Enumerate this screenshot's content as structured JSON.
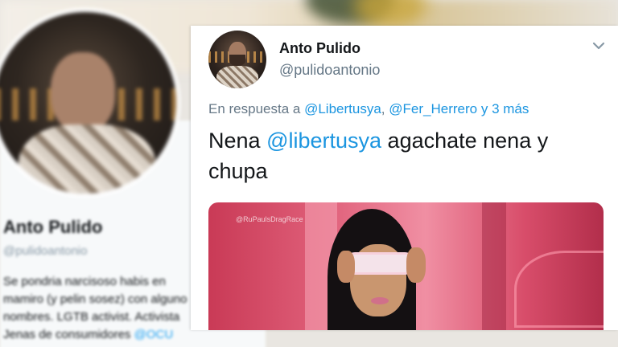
{
  "background_profile": {
    "name": "Anto Pulido",
    "handle": "@pulidoantonio",
    "bio_lines": [
      "Se pondria narcisoso habis en",
      "mamiro (y pelin sosez) con alguno",
      "nombres. LGTB activist. Activista",
      "Jenas de consumidores"
    ],
    "bio_link": "@OCU"
  },
  "tweet": {
    "author_name": "Anto Pulido",
    "author_handle": "@pulidoantonio",
    "menu_icon": "chevron-down-icon",
    "reply_prefix": "En respuesta a",
    "reply_user_1": "@Libertusya",
    "reply_separator": ",",
    "reply_user_2": "@Fer_Herrero",
    "reply_suffix": "y 3 más",
    "text_before": "Nena",
    "text_mention": "@libertusya",
    "text_after": "agachate nena y chupa",
    "media_watermark": "@RuPaulsDragRace"
  },
  "colors": {
    "link": "#1b95e0",
    "text": "#14171a",
    "secondary": "#657786"
  }
}
